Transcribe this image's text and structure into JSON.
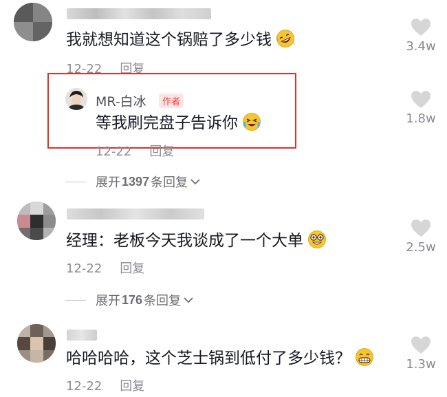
{
  "comments": [
    {
      "text": "我就想知道这个锅赔了多少钱",
      "date": "12-22",
      "reply_label": "回复",
      "likes": "3.4w",
      "emoji": "rofl-emoji"
    },
    {
      "text": "经理：老板今天我谈成了一个大单",
      "date": "12-22",
      "reply_label": "回复",
      "likes": "2.5w",
      "emoji": "nerd-emoji"
    },
    {
      "text": "哈哈哈哈，这个芝士锅到低付了多少钱？",
      "date": "12-22",
      "reply_label": "回复",
      "likes": "1.3w",
      "emoji": "grin-emoji"
    }
  ],
  "reply": {
    "author": "MR-白冰",
    "badge": "作者",
    "text": "等我刷完盘子告诉你",
    "date": "12-22",
    "reply_label": "回复",
    "likes": "1.8w",
    "emoji": "crying-laughing-emoji"
  },
  "expand": [
    {
      "prefix": "展开",
      "count": "1397",
      "suffix": "条回复"
    },
    {
      "prefix": "展开",
      "count": "176",
      "suffix": "条回复"
    }
  ],
  "colors": {
    "text": "#161823",
    "meta": "#8a8b91",
    "like_heart": "#d6d6d6",
    "highlight_border": "#d8322d",
    "badge_text": "#ee3b3b",
    "badge_bg": "#fde5e5"
  },
  "icons": {
    "like": "heart-icon",
    "expand": "chevron-down-icon"
  }
}
